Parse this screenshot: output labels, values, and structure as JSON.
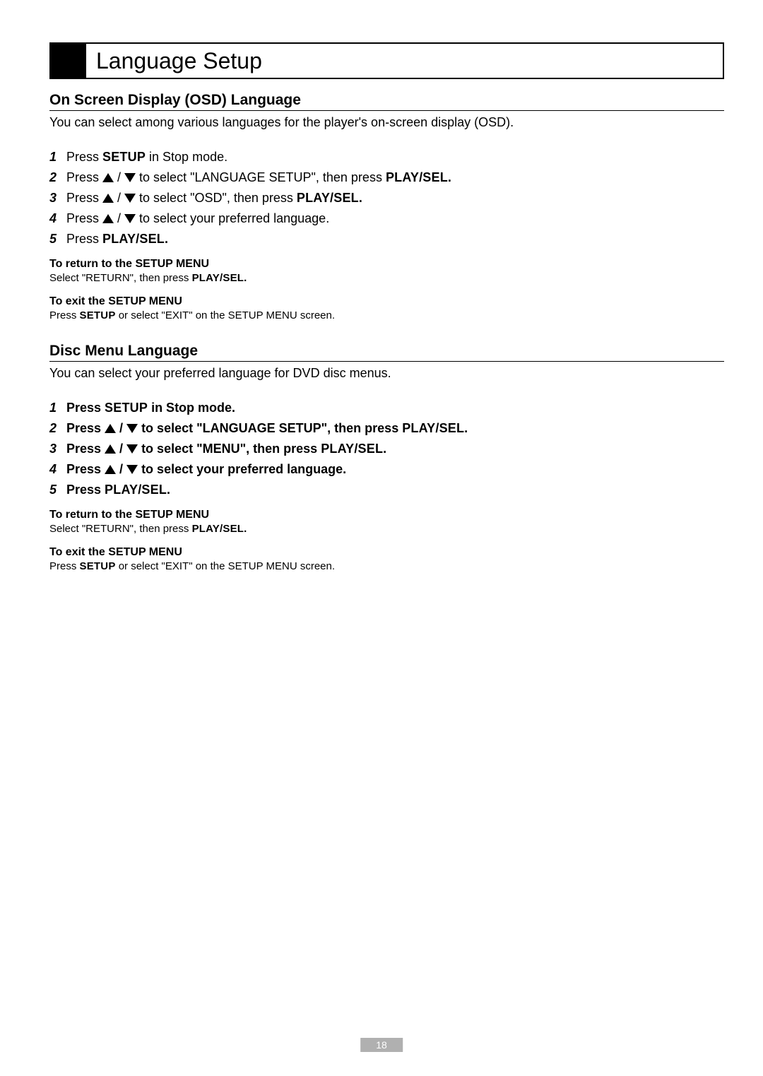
{
  "title": "Language Setup",
  "pageNumber": "18",
  "sectionA": {
    "heading": "On Screen Display (OSD) Language",
    "intro": "You can select among various languages for the player's on-screen display (OSD).",
    "steps": {
      "s1a": "Press ",
      "s1button": "SETUP",
      "s1b": " in Stop mode.",
      "s2a": "Press ",
      "s2mid": " to select \"LANGUAGE SETUP\", then press ",
      "s2button": "PLAY/SEL.",
      "s3a": "Press ",
      "s3mid": " to select \"OSD\", then press ",
      "s3button": "PLAY/SEL.",
      "s4a": "Press ",
      "s4b": " to select your preferred language.",
      "s5a": "Press ",
      "s5button": "PLAY/SEL."
    },
    "return": {
      "heading": "To return to the SETUP MENU",
      "body_a": "Select \"RETURN\", then press ",
      "body_button": "PLAY/SEL."
    },
    "exit": {
      "heading": "To exit the SETUP MENU",
      "body_a": "Press ",
      "body_button": "SETUP",
      "body_b": " or select \"EXIT\" on the SETUP MENU screen."
    }
  },
  "sectionB": {
    "heading": "Disc Menu Language",
    "intro": "You can select your preferred language for DVD disc menus.",
    "steps": {
      "s1a": "Press ",
      "s1button": "SETUP",
      "s1b": " in Stop mode.",
      "s2a": "Press ",
      "s2mid": " to select \"LANGUAGE SETUP\", then press ",
      "s2button": "PLAY/SEL.",
      "s3a": "Press ",
      "s3mid": " to select \"MENU\", then press ",
      "s3button": "PLAY/SEL.",
      "s4a": "Press ",
      "s4b": "  to select your preferred language.",
      "s5a": "Press ",
      "s5button": "PLAY/SEL."
    },
    "return": {
      "heading": "To return to the SETUP MENU",
      "body_a": "Select \"RETURN\", then press ",
      "body_button": "PLAY/SEL."
    },
    "exit": {
      "heading": "To exit the SETUP MENU",
      "body_a": "Press ",
      "body_button": "SETUP",
      "body_b": " or select \"EXIT\" on the SETUP MENU screen."
    }
  }
}
